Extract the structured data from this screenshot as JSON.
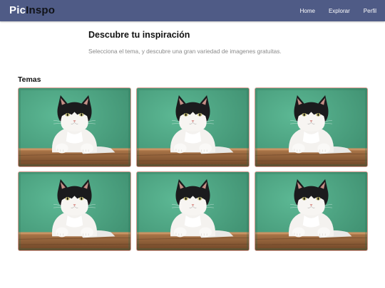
{
  "header": {
    "logo_part1": "Pic",
    "logo_part2": "Inspo",
    "nav": [
      "Home",
      "Explorar",
      "Perfil"
    ]
  },
  "hero": {
    "title": "Descubre tu inspiración",
    "subtitle": "Selecciona el tema, y descubre una gran variedad de imagenes gratuitas."
  },
  "section": {
    "title": "Temas"
  },
  "cards_count": 6,
  "colors": {
    "navbar": "#4f5b86",
    "card_border": "#d79a90",
    "photo_background": "#4fa583"
  }
}
